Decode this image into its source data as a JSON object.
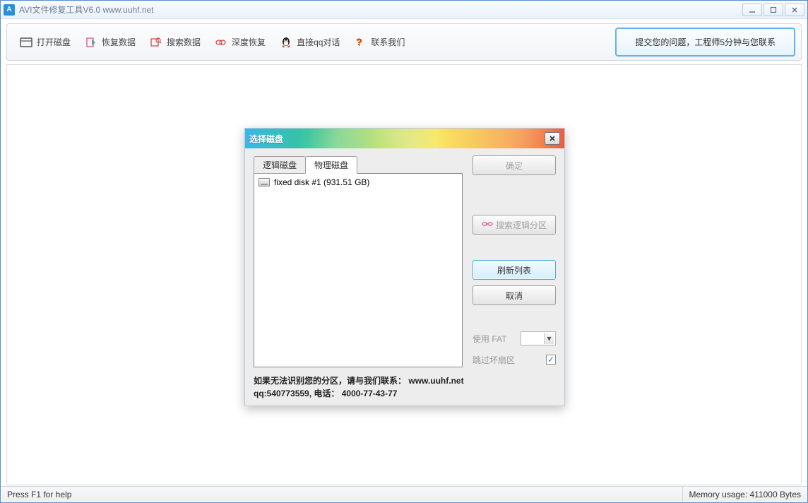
{
  "window": {
    "title": "AVI文件修复工具V6.0 www.uuhf.net"
  },
  "toolbar": {
    "open_disk": "打开磁盘",
    "recover_data": "恢复数据",
    "search_data": "搜索数据",
    "deep_recover": "深度恢复",
    "qq_chat": "直接qq对话",
    "contact_us": "联系我们",
    "engineer": "提交您的问题，工程师5分钟与您联系"
  },
  "dialog": {
    "title": "选择磁盘",
    "tabs": {
      "logical": "逻辑磁盘",
      "physical": "物理磁盘"
    },
    "disk_item": "fixed disk #1   (931.51 GB)",
    "btn_ok": "确定",
    "btn_search": "搜索逻辑分区",
    "btn_refresh": "刷新列表",
    "btn_cancel": "取消",
    "opt_fat": "使用 FAT",
    "opt_skip": "跳过坏扇区",
    "footer_line1_a": "如果无法识别您的分区，请与我们联系：",
    "footer_line1_b": "www.uuhf.net",
    "footer_line2": "qq:540773559, 电话： 4000-77-43-77"
  },
  "status": {
    "help": "Press F1 for help",
    "memory": "Memory usage: 411000 Bytes"
  }
}
